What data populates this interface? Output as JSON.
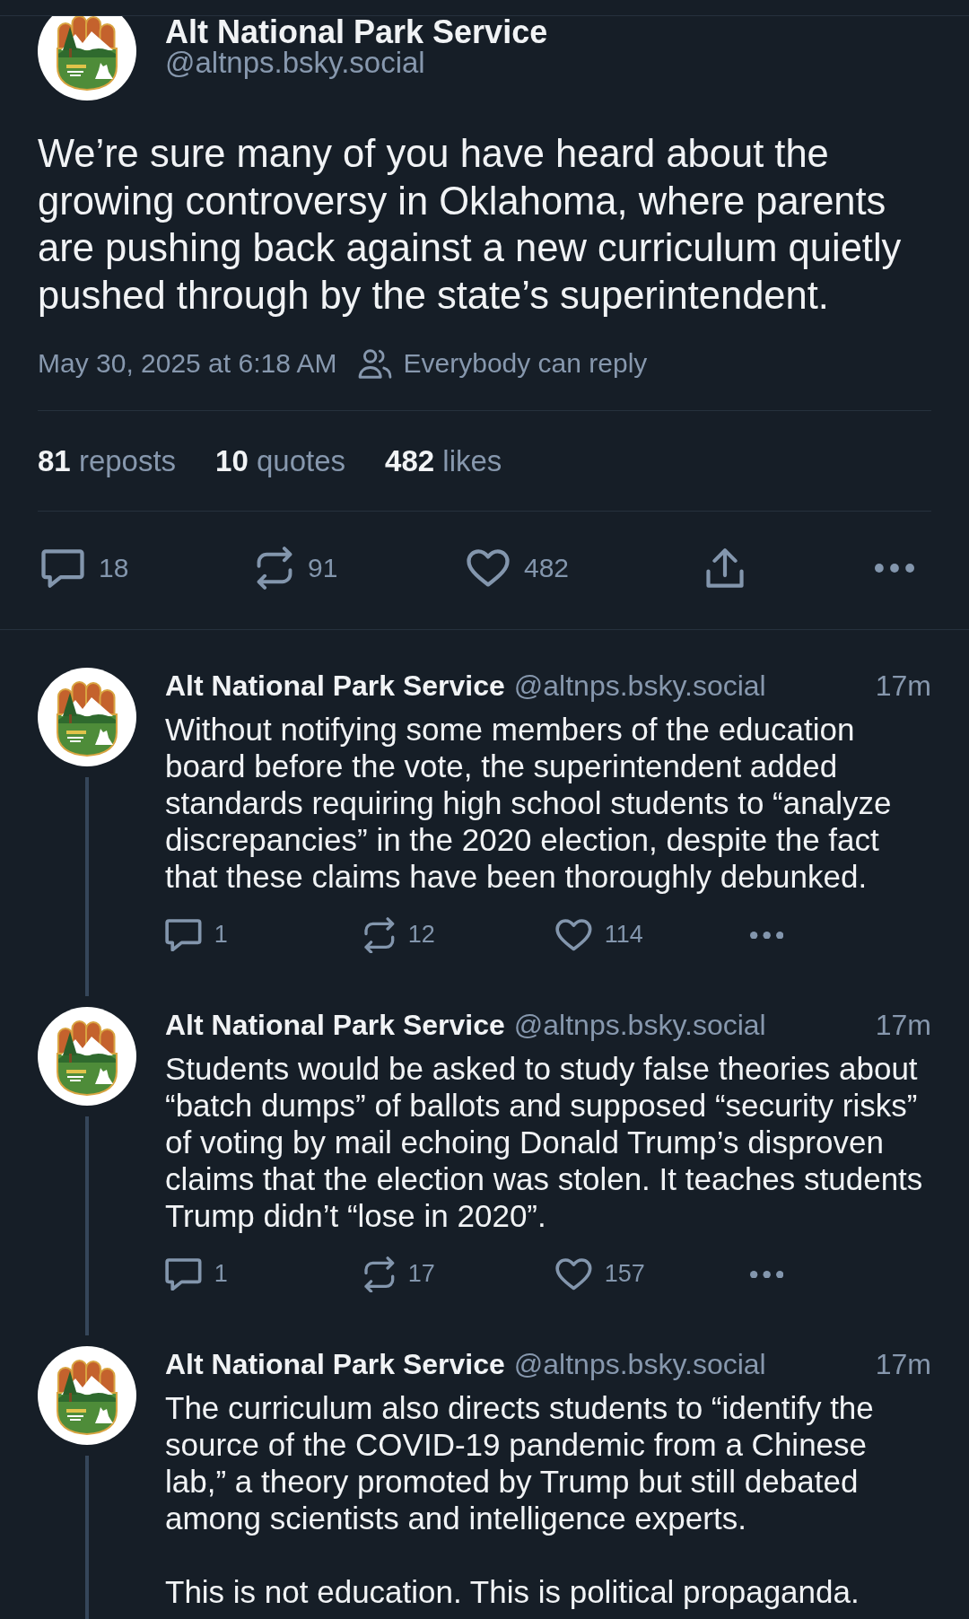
{
  "post": {
    "author": {
      "name": "Alt National Park Service",
      "handle": "@altnps.bsky.social"
    },
    "text": "We’re sure many of you have heard about the growing controversy in Oklahoma, where parents are pushing back against a new curriculum quietly pushed through by the state’s superintendent.",
    "timestamp": "May 30, 2025 at 6:18 AM",
    "reply_setting": "Everybody can reply",
    "stats": [
      {
        "count": "81",
        "label": "reposts"
      },
      {
        "count": "10",
        "label": "quotes"
      },
      {
        "count": "482",
        "label": "likes"
      }
    ],
    "actions": [
      {
        "kind": "reply",
        "count": "18"
      },
      {
        "kind": "repost",
        "count": "91"
      },
      {
        "kind": "like",
        "count": "482"
      },
      {
        "kind": "share"
      },
      {
        "kind": "more"
      }
    ]
  },
  "replies": [
    {
      "author": {
        "name": "Alt National Park Service",
        "handle": "@altnps.bsky.social"
      },
      "time": "17m",
      "text": "Without notifying some members of the education board before the vote, the superintendent added standards requiring high school students to “analyze discrepancies” in the 2020 election, despite the fact that these claims have been thoroughly debunked.",
      "actions": [
        {
          "kind": "reply",
          "count": "1"
        },
        {
          "kind": "repost",
          "count": "12"
        },
        {
          "kind": "like",
          "count": "114"
        },
        {
          "kind": "more"
        }
      ]
    },
    {
      "author": {
        "name": "Alt National Park Service",
        "handle": "@altnps.bsky.social"
      },
      "time": "17m",
      "text": "Students would be asked to study false theories about “batch dumps” of ballots and supposed “security risks” of voting by mail echoing Donald Trump’s disproven claims that the election was stolen. It teaches students Trump didn’t “lose in 2020”.",
      "actions": [
        {
          "kind": "reply",
          "count": "1"
        },
        {
          "kind": "repost",
          "count": "17"
        },
        {
          "kind": "like",
          "count": "157"
        },
        {
          "kind": "more"
        }
      ]
    },
    {
      "author": {
        "name": "Alt National Park Service",
        "handle": "@altnps.bsky.social"
      },
      "time": "17m",
      "text": "The curriculum also directs students to “identify the source of the COVID-19 pandemic from a Chinese lab,” a theory promoted by Trump but still debated among scientists and intelligence experts.\n\nThis is not education. This is political propaganda."
    }
  ]
}
